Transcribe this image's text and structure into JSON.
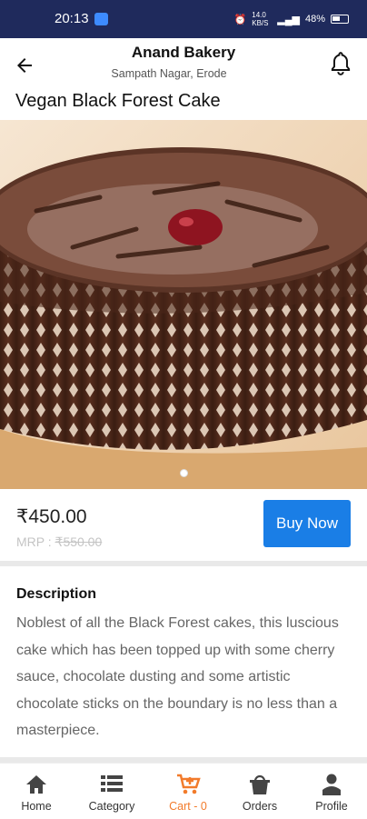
{
  "status_bar": {
    "time": "20:13",
    "battery": "48%",
    "net": "14.0 KB/S"
  },
  "header": {
    "shop_name": "Anand Bakery",
    "location": "Sampath Nagar, Erode"
  },
  "product": {
    "title": "Vegan Black Forest Cake",
    "price": "₹450.00",
    "mrp_label": "MRP : ",
    "mrp_value": "₹550.00",
    "buy_label": "Buy Now"
  },
  "description": {
    "heading": "Description",
    "text": "Noblest of all the Black Forest cakes, this luscious cake which has been topped up with some cherry sauce, chocolate dusting and some artistic chocolate sticks on the boundary is no less than a masterpiece."
  },
  "bottom_nav": [
    {
      "label": "Home",
      "icon": "home-icon"
    },
    {
      "label": "Category",
      "icon": "list-icon"
    },
    {
      "label": "Cart - 0",
      "icon": "cart-icon"
    },
    {
      "label": "Orders",
      "icon": "bag-icon"
    },
    {
      "label": "Profile",
      "icon": "person-icon"
    }
  ],
  "colors": {
    "statusbar": "#1f2a5c",
    "accent": "#1a7ee6",
    "active_nav": "#f27b2b"
  }
}
